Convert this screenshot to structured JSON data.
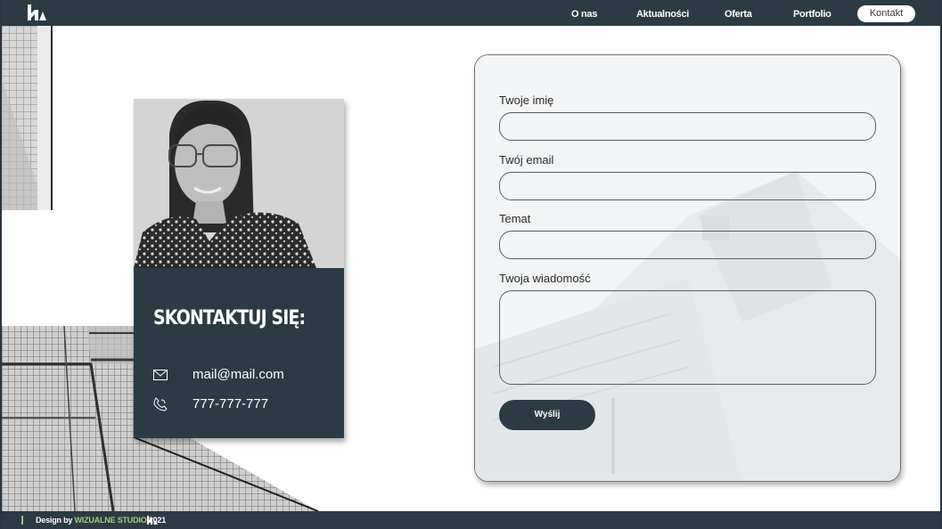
{
  "nav": {
    "items": [
      "O nas",
      "Aktualności",
      "Oferta",
      "Portfolio"
    ],
    "active": "Kontakt"
  },
  "card": {
    "title": "SKONTAKTUJ SIĘ:",
    "email": "mail@mail.com",
    "phone": "777-777-777"
  },
  "form": {
    "name_label": "Twoje imię",
    "email_label": "Twój email",
    "subject_label": "Temat",
    "message_label": "Twoja wiadomość",
    "name_value": "",
    "email_value": "",
    "subject_value": "",
    "message_value": "",
    "submit_label": "Wyślij"
  },
  "footer": {
    "prefix": "Design by ",
    "studio": "WIZUALNE STUDIO",
    "year": " 2021"
  },
  "colors": {
    "primary": "#2c3a44",
    "accent": "#9ed27a",
    "background": "#ffffff"
  }
}
